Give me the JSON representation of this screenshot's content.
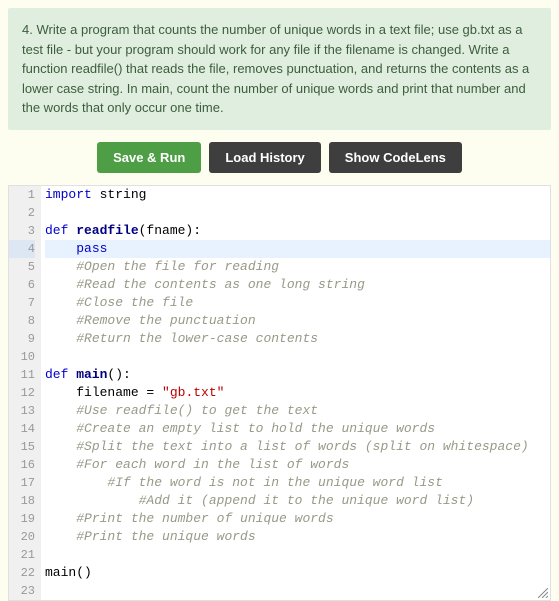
{
  "problem": {
    "text": "4. Write a program that counts the number of unique words in a text file; use gb.txt as a test file - but your program should work for any file if the filename is changed. Write a function readfile() that reads the file, removes punctuation, and returns the contents as a lower case string. In main, count the number of unique words and print that number and the words that only occur one time."
  },
  "buttons": {
    "save_run": "Save & Run",
    "load_history": "Load History",
    "show_codelens": "Show CodeLens"
  },
  "editor": {
    "highlighted_line": 4,
    "line_numbers": [
      "1",
      "2",
      "3",
      "4",
      "5",
      "6",
      "7",
      "8",
      "9",
      "10",
      "11",
      "12",
      "13",
      "14",
      "15",
      "16",
      "17",
      "18",
      "19",
      "20",
      "21",
      "22",
      "23"
    ],
    "lines": {
      "l1": {
        "import_kw": "import",
        "rest": " string"
      },
      "l2": "",
      "l3": {
        "def_kw": "def",
        "fn": " readfile",
        "args": "(fname):"
      },
      "l4": {
        "indent": "    ",
        "kw": "pass"
      },
      "l5": {
        "indent": "    ",
        "com": "#Open the file for reading"
      },
      "l6": {
        "indent": "    ",
        "com": "#Read the contents as one long string"
      },
      "l7": {
        "indent": "    ",
        "com": "#Close the file"
      },
      "l8": {
        "indent": "    ",
        "com": "#Remove the punctuation"
      },
      "l9": {
        "indent": "    ",
        "com": "#Return the lower-case contents"
      },
      "l10": "",
      "l11": {
        "def_kw": "def",
        "fn": " main",
        "args": "():"
      },
      "l12": {
        "indent": "    ",
        "var": "filename = ",
        "str": "\"gb.txt\""
      },
      "l13": {
        "indent": "    ",
        "com": "#Use readfile() to get the text"
      },
      "l14": {
        "indent": "    ",
        "com": "#Create an empty list to hold the unique words"
      },
      "l15": {
        "indent": "    ",
        "com": "#Split the text into a list of words (split on whitespace)"
      },
      "l16": {
        "indent": "    ",
        "com": "#For each word in the list of words"
      },
      "l17": {
        "indent": "        ",
        "com": "#If the word is not in the unique word list"
      },
      "l18": {
        "indent": "            ",
        "com": "#Add it (append it to the unique word list)"
      },
      "l19": {
        "indent": "    ",
        "com": "#Print the number of unique words"
      },
      "l20": {
        "indent": "    ",
        "com": "#Print the unique words"
      },
      "l21": "",
      "l22": "main()",
      "l23": ""
    }
  }
}
